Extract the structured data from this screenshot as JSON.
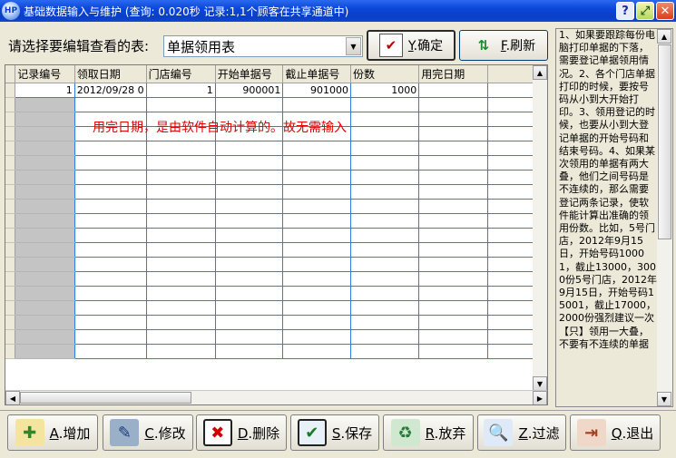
{
  "window": {
    "title": "基础数据输入与维护 (查询: 0.020秒 记录:1,1个顾客在共享通道中)",
    "icon_label": "HP"
  },
  "toolbar": {
    "select_label": "请选择要编辑查看的表:",
    "selected_table": "单据领用表",
    "confirm": {
      "key": "Y",
      "label": ".确定",
      "icon": "check-icon"
    },
    "refresh": {
      "key": "F",
      "label": ".刷新",
      "icon": "refresh-icon"
    }
  },
  "grid": {
    "columns": [
      "记录编号",
      "领取日期",
      "门店编号",
      "开始单据号",
      "截止单据号",
      "份数",
      "用完日期"
    ],
    "rows": [
      [
        "1",
        "2012/09/28 0",
        "1",
        "900001",
        "901000",
        "1000",
        ""
      ]
    ],
    "note": "用完日期，是由软件自动计算的。故无需输入"
  },
  "help_text": "1、如果要跟踪每份电脑打印单据的下落，需要登记单据领用情况。2、各个门店单据打印的时候，要按号码从小到大开始打印。3、领用登记的时候，也要从小到大登记单据的开始号码和结束号码。4、如果某次领用的单据有两大叠，他们之间号码是不连续的，那么需要登记两条记录，使软件能计算出准确的领用份数。比如，5号门店，2012年9月15日，开始号码10001，截止13000，3000份5号门店，2012年9月15日，开始号码15001，截止17000，2000份强烈建议一次【只】领用一大叠，不要有不连续的单据",
  "actions": [
    {
      "key": "A",
      "label": ".增加",
      "icon": "add-icon"
    },
    {
      "key": "C",
      "label": ".修改",
      "icon": "edit-icon"
    },
    {
      "key": "D",
      "label": ".删除",
      "icon": "delete-icon"
    },
    {
      "key": "S",
      "label": ".保存",
      "icon": "save-icon"
    },
    {
      "key": "R",
      "label": ".放弃",
      "icon": "discard-icon"
    },
    {
      "key": "Z",
      "label": ".过滤",
      "icon": "filter-icon"
    },
    {
      "key": "Q",
      "label": ".退出",
      "icon": "exit-icon"
    }
  ]
}
